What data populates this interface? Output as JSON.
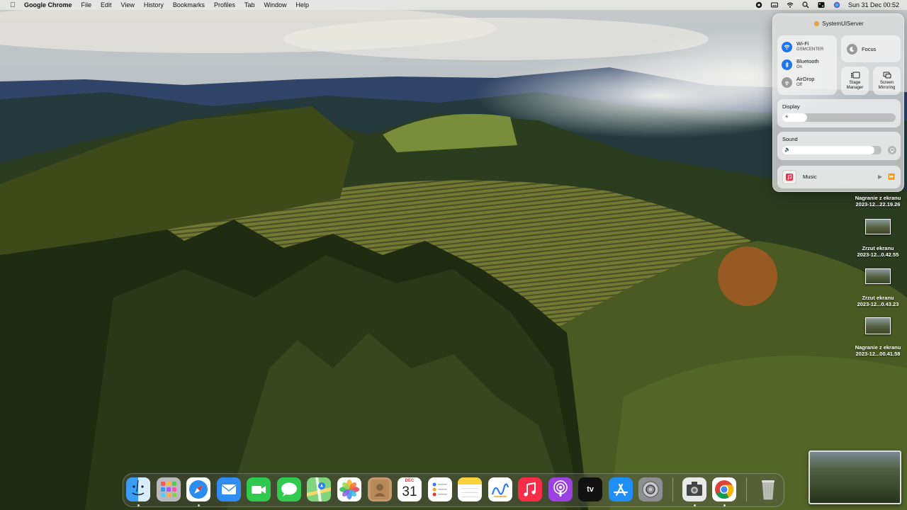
{
  "menubar": {
    "app_name": "Google Chrome",
    "menus": [
      "File",
      "Edit",
      "View",
      "History",
      "Bookmarks",
      "Profiles",
      "Tab",
      "Window",
      "Help"
    ],
    "clock": "Sun 31 Dec  00:52",
    "status_icons": [
      "record-icon",
      "keyboard-icon",
      "wifi-icon",
      "search-icon",
      "control-center-icon",
      "siri-icon"
    ]
  },
  "control_center": {
    "title": "SystemUIServer",
    "wifi": {
      "label": "Wi-Fi",
      "status": "GSMCENTER"
    },
    "bluetooth": {
      "label": "Bluetooth",
      "status": "On"
    },
    "airdrop": {
      "label": "AirDrop",
      "status": "Off"
    },
    "focus": {
      "label": "Focus"
    },
    "stage_manager": {
      "label": "Stage Manager"
    },
    "screen_mirroring": {
      "label": "Screen Mirroring"
    },
    "display": {
      "label": "Display",
      "level": 0.22
    },
    "sound": {
      "label": "Sound",
      "level": 0.93
    },
    "music": {
      "label": "Music"
    }
  },
  "desktop_files": [
    {
      "name": "Nagranie z ekranu",
      "detail": "2023-12...22.19.26"
    },
    {
      "name": "Zrzut ekranu",
      "detail": "2023-12...0.42.55"
    },
    {
      "name": "Zrzut ekranu",
      "detail": "2023-12...0.43.23"
    },
    {
      "name": "Nagranie z ekranu",
      "detail": "2023-12...00.41.58"
    }
  ],
  "dock": {
    "apps": [
      "Finder",
      "Launchpad",
      "Safari",
      "Mail",
      "FaceTime",
      "Messages",
      "Maps",
      "Photos",
      "Contacts",
      "Calendar",
      "Reminders",
      "Notes",
      "Freeform",
      "Music",
      "Podcasts",
      "TV",
      "App Store",
      "System Settings",
      "Screenshot",
      "Google Chrome",
      "Trash"
    ],
    "calendar": {
      "month": "DEC",
      "day": "31"
    },
    "tv_label": "tv"
  },
  "colors": {
    "accent_blue": "#1d74f5",
    "menubar_bg": "#e6e6e4"
  }
}
